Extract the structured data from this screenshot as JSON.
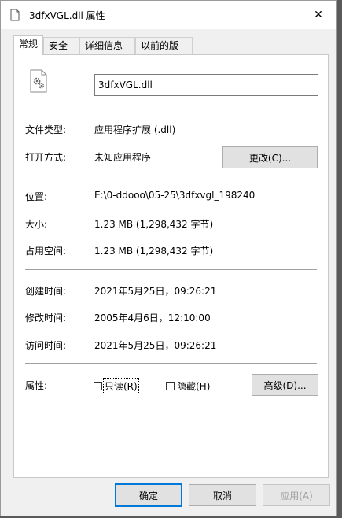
{
  "window": {
    "title": "3dfxVGL.dll 属性",
    "close_glyph": "✕"
  },
  "tabs": [
    {
      "label": "常规",
      "active": true
    },
    {
      "label": "安全",
      "active": false
    },
    {
      "label": "详细信息",
      "active": false
    },
    {
      "label": "以前的版本",
      "active": false
    }
  ],
  "general": {
    "file_icon": "dll-settings-file-icon",
    "filename": "3dfxVGL.dll",
    "file_type_label": "文件类型:",
    "file_type_value": "应用程序扩展 (.dll)",
    "opens_with_label": "打开方式:",
    "opens_with_value": "未知应用程序",
    "change_button": "更改(C)...",
    "location_label": "位置:",
    "location_value": "E:\\0-ddooo\\05-25\\3dfxvgl_198240",
    "size_label": "大小:",
    "size_value": "1.23 MB (1,298,432 字节)",
    "size_on_disk_label": "占用空间:",
    "size_on_disk_value": "1.23 MB (1,298,432 字节)",
    "created_label": "创建时间:",
    "created_value": "2021年5月25日，09:26:21",
    "modified_label": "修改时间:",
    "modified_value": "2005年4月6日，12:10:00",
    "accessed_label": "访问时间:",
    "accessed_value": "2021年5月25日，09:26:21",
    "attributes_label": "属性:",
    "readonly_label": "只读(R)",
    "hidden_label": "隐藏(H)",
    "advanced_button": "高级(D)..."
  },
  "footer": {
    "ok_button": "确定",
    "cancel_button": "取消",
    "apply_button": "应用(A)"
  },
  "colors": {
    "accent": "#0078d7",
    "window_bg": "#f0f0f0",
    "panel_bg": "#ffffff"
  }
}
